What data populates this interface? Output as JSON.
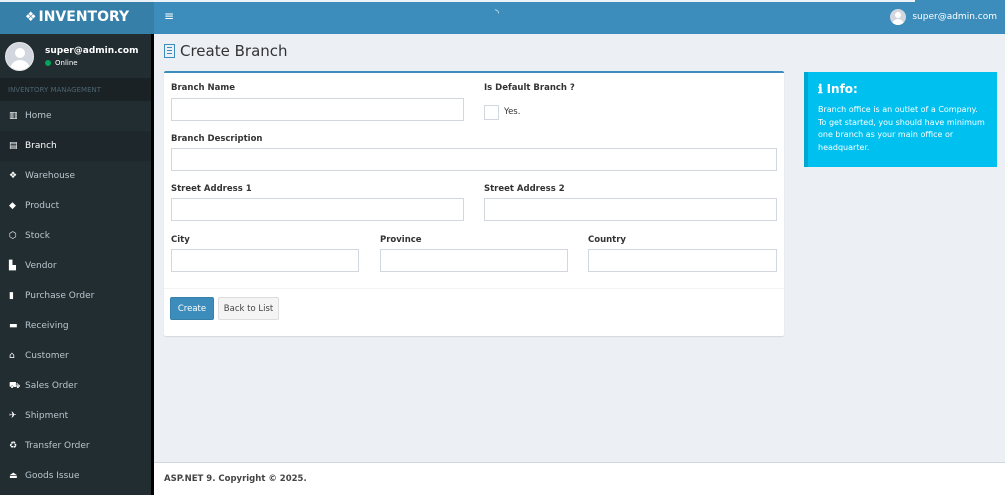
{
  "brand": {
    "icon": "cubes-icon",
    "text": "INVENTORY"
  },
  "user": {
    "email": "super@admin.com",
    "status": "Online"
  },
  "navbar": {
    "toggle_icon": "bars-icon",
    "loading_icon": "spinner-icon",
    "user": "super@admin.com"
  },
  "sidebar": {
    "header": "INVENTORY MANAGEMENT",
    "items": [
      {
        "label": "Home",
        "icon": "bar-chart-icon",
        "glyph": "📊"
      },
      {
        "label": "Branch",
        "icon": "building-icon",
        "glyph": "▤"
      },
      {
        "label": "Warehouse",
        "icon": "cubes-icon",
        "glyph": "❖"
      },
      {
        "label": "Product",
        "icon": "tag-icon",
        "glyph": "◆"
      },
      {
        "label": "Stock",
        "icon": "cube-icon",
        "glyph": "⬡"
      },
      {
        "label": "Vendor",
        "icon": "industry-icon",
        "glyph": "▙"
      },
      {
        "label": "Purchase Order",
        "icon": "file-icon",
        "glyph": "▮"
      },
      {
        "label": "Receiving",
        "icon": "truck-icon",
        "glyph": "▬"
      },
      {
        "label": "Customer",
        "icon": "bank-icon",
        "glyph": "⌂"
      },
      {
        "label": "Sales Order",
        "icon": "cart-icon",
        "glyph": "⛟"
      },
      {
        "label": "Shipment",
        "icon": "plane-icon",
        "glyph": "✈"
      },
      {
        "label": "Transfer Order",
        "icon": "recycle-icon",
        "glyph": "♻"
      },
      {
        "label": "Goods Issue",
        "icon": "upload-icon",
        "glyph": "⏏"
      }
    ]
  },
  "page": {
    "title": "Create Branch",
    "title_icon": "building-icon"
  },
  "form": {
    "branch_name": {
      "label": "Branch Name",
      "value": ""
    },
    "is_default": {
      "label": "Is Default Branch ?",
      "option": "Yes.",
      "checked": false
    },
    "branch_description": {
      "label": "Branch Description",
      "value": ""
    },
    "street1": {
      "label": "Street Address 1",
      "value": ""
    },
    "street2": {
      "label": "Street Address 2",
      "value": ""
    },
    "city": {
      "label": "City",
      "value": ""
    },
    "province": {
      "label": "Province",
      "value": ""
    },
    "country": {
      "label": "Country",
      "value": ""
    },
    "create_label": "Create",
    "back_label": "Back to List"
  },
  "info": {
    "title": "Info:",
    "icon": "info-icon",
    "text": "Branch office is an outlet of a Company. To get started, you should have minimum one branch as your main office or headquarter."
  },
  "footer": {
    "text": "ASP.NET 9. Copyright © 2025."
  },
  "colors": {
    "sidebar": "#222d32",
    "navbar": "#3c8dbc",
    "logo": "#367fa9",
    "callout": "#00c0ef",
    "primary": "#3c8dbc"
  }
}
